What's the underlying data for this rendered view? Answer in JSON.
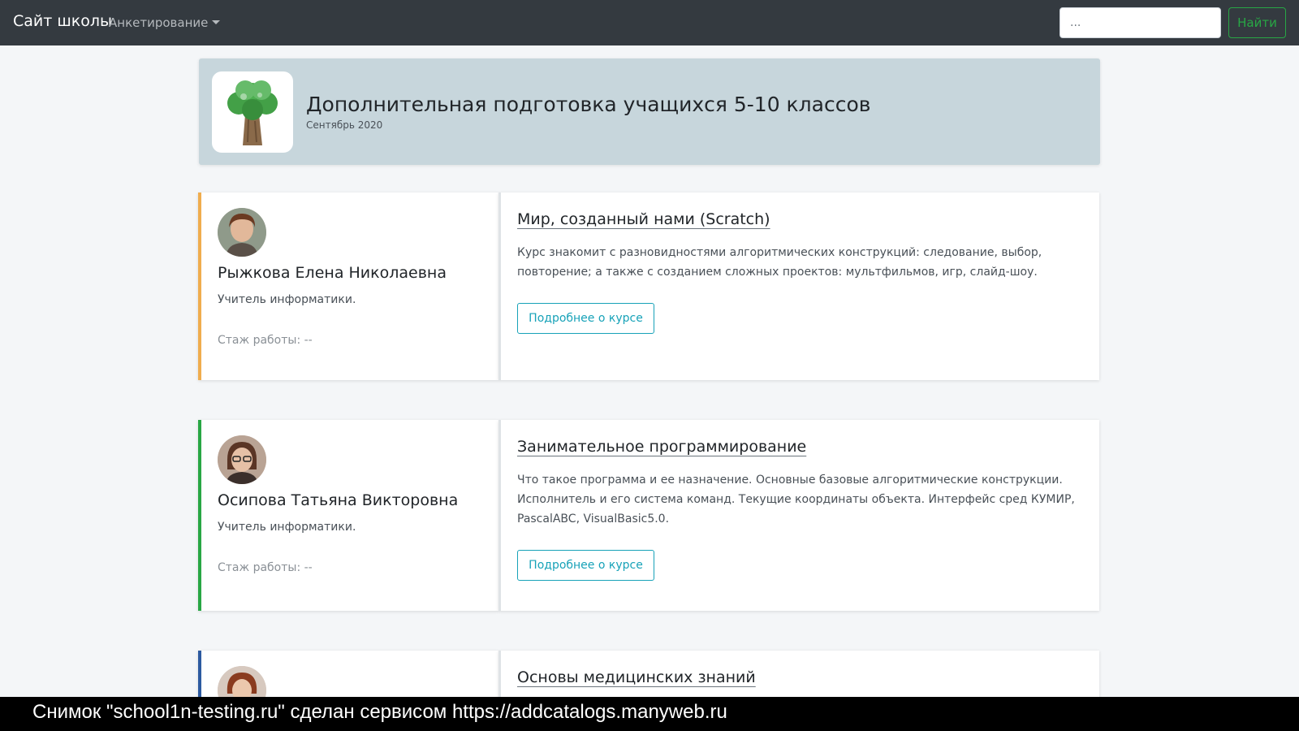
{
  "navbar": {
    "brand": "Сайт школы",
    "dropdown_label": "Анкетирование",
    "search_placeholder": "...",
    "search_button": "Найти"
  },
  "header": {
    "title": "Дополнительная подготовка учащихся 5-10 классов",
    "subtitle": "Сентябрь 2020"
  },
  "courses": [
    {
      "teacher_name": "Рыжкова Елена Николаевна",
      "teacher_role": "Учитель информатики.",
      "teacher_experience": "Стаж работы: --",
      "accent_color": "#f0ad4e",
      "course_title": "Мир, созданный нами (Scratch)",
      "course_description": "Курс знакомит с разновидностями алгоритмических конструкций: следование, выбор, повторение; а также с созданием сложных проектов: мультфильмов, игр, слайд-шоу.",
      "button_label": "Подробнее о курсе"
    },
    {
      "teacher_name": "Осипова Татьяна Викторовна",
      "teacher_role": "Учитель информатики.",
      "teacher_experience": "Стаж работы: --",
      "accent_color": "#28a745",
      "course_title": "Занимательное программирование",
      "course_description": "Что такое программа и ее назначение. Основные базовые алгоритмические конструкции. Исполнитель и его система команд. Текущие координаты объекта. Интерфейс сред КУМИР, PascalABC, VisualBasic5.0.",
      "button_label": "Подробнее о курсе"
    },
    {
      "accent_color": "#2c5aa0",
      "course_title": "Основы медицинских знаний"
    }
  ],
  "footer_banner": "Снимок \"school1n-testing.ru\" сделан сервисом https://addcatalogs.manyweb.ru"
}
